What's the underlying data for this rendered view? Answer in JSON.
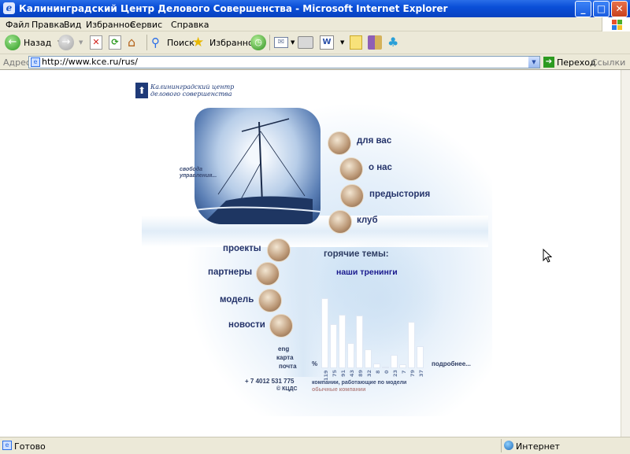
{
  "window": {
    "title": "Калининградский Центр Делового Совершенства - Microsoft Internet Explorer",
    "buttons": {
      "minimize": "_",
      "maximize": "□",
      "close": "✕"
    }
  },
  "menu": [
    "Файл",
    "Правка",
    "Вид",
    "Избранное",
    "Сервис",
    "Справка"
  ],
  "toolbar": {
    "back_label": "Назад",
    "search_label": "Поиск",
    "favorites_label": "Избранное"
  },
  "address": {
    "label": "Адрес:",
    "url": "http://www.kce.ru/rus/",
    "go_label": "Переход",
    "links_label": "Ссылки"
  },
  "status": {
    "left": "Готово",
    "zone": "Интернет"
  },
  "site": {
    "logo_line1": "Калининградский центр",
    "logo_line2": "делового совершенства",
    "slogan_line1": "свобода",
    "slogan_line2": "управления...",
    "nav_right": [
      "для вас",
      "о нас",
      "предыстория",
      "клуб"
    ],
    "nav_left": [
      "проекты",
      "партнеры",
      "модель",
      "новости"
    ],
    "hot_topics_title": "горячие темы:",
    "hot_topic_1": "наши тренинги",
    "link_eng": "eng",
    "link_map": "карта",
    "link_mail": "почта",
    "phone": "+ 7 4012 531 775",
    "copyright": "© КЦДС",
    "chart_percent_label": "%",
    "chart_more": "подробнее...",
    "legend_1": "компании, работающие по модели",
    "legend_2": "обычные компании",
    "accent": "#2d3c62"
  },
  "chart_data": {
    "type": "bar",
    "categories": [
      "119",
      "75",
      "91",
      "43",
      "89",
      "32",
      "8",
      "0",
      "23",
      "7",
      "79",
      "37"
    ],
    "values": [
      119,
      75,
      91,
      43,
      89,
      32,
      8,
      0,
      23,
      7,
      79,
      37
    ]
  }
}
